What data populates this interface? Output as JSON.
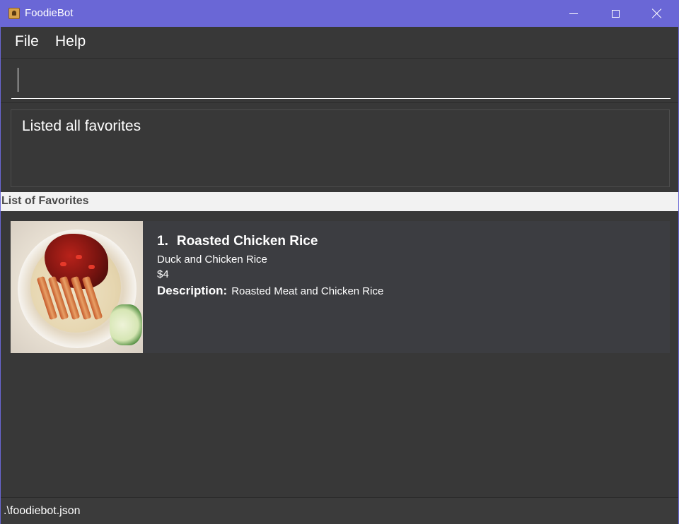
{
  "window": {
    "title": "FoodieBot",
    "controls": {
      "minimize_icon": "minimize-icon",
      "maximize_icon": "maximize-icon",
      "close_icon": "close-icon"
    },
    "accent_color": "#6a67d6"
  },
  "menu": {
    "items": [
      {
        "label": "File"
      },
      {
        "label": "Help"
      }
    ]
  },
  "command": {
    "value": ""
  },
  "result": {
    "message": "Listed all favorites"
  },
  "list": {
    "header": "List of Favorites",
    "items": [
      {
        "index": "1.",
        "name": "Roasted Chicken Rice",
        "stall": "Duck and Chicken Rice",
        "price": "$4",
        "description_label": "Description:",
        "description": "Roasted Meat and Chicken Rice",
        "image": "roasted-chicken-rice-photo"
      }
    ]
  },
  "status": {
    "file_path": ".\\foodiebot.json"
  }
}
